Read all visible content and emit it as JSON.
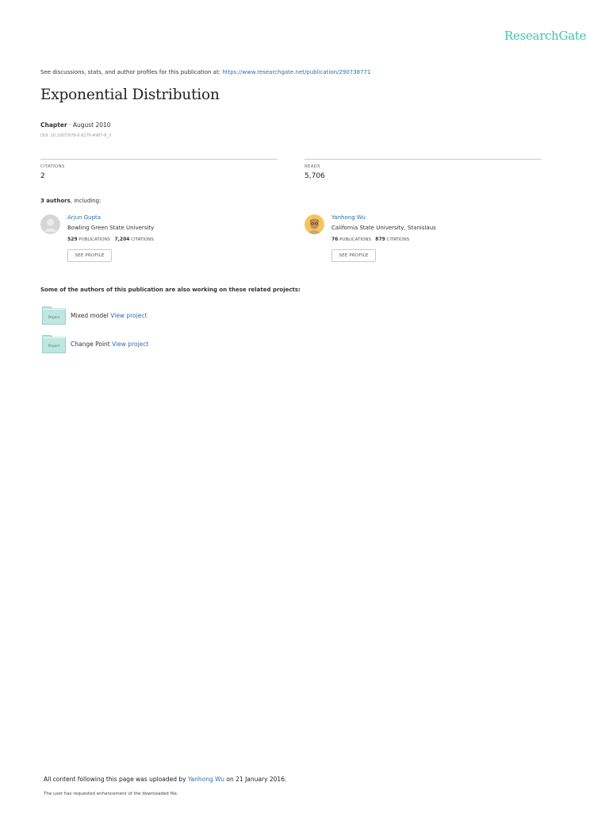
{
  "header": {
    "logo_text": "ResearchGate",
    "discuss_prefix": "See discussions, stats, and author profiles for this publication at: ",
    "discuss_url": "https://www.researchgate.net/publication/290738771"
  },
  "publication": {
    "title": "Exponential Distribution",
    "type": "Chapter",
    "separator": " · ",
    "date": "August 2010",
    "doi": "DOI: 10.1007/978-0-8176-4987-6_2"
  },
  "stats": {
    "citations_label": "CITATIONS",
    "citations_value": "2",
    "reads_label": "READS",
    "reads_value": "5,706"
  },
  "authors_header": {
    "count": "3 authors",
    "suffix": ", including:"
  },
  "authors": [
    {
      "name": "Arjun Gupta",
      "institution": "Bowling Green State University",
      "publications": "529",
      "publications_label": "PUBLICATIONS",
      "citations": "7,204",
      "citations_label": "CITATIONS",
      "button": "SEE PROFILE"
    },
    {
      "name": "Yanhong Wu",
      "institution": "California State University, Stanislaus",
      "publications": "76",
      "publications_label": "PUBLICATIONS",
      "citations": "879",
      "citations_label": "CITATIONS",
      "button": "SEE PROFILE"
    }
  ],
  "related": {
    "header": "Some of the authors of this publication are also working on these related projects:",
    "projects": [
      {
        "icon_label": "Project",
        "name": "Mixed model",
        "link": "View project"
      },
      {
        "icon_label": "Project",
        "name": "Change Point",
        "link": "View project"
      }
    ]
  },
  "footer": {
    "prefix": "All content following this page was uploaded by ",
    "uploader": "Yanhong Wu",
    "suffix": " on 21 January 2016.",
    "note": "The user has requested enhancement of the downloaded file."
  },
  "colors": {
    "brand": "#40c5b0",
    "link": "#2c6fb0",
    "project_icon": "#bfe6e0"
  }
}
